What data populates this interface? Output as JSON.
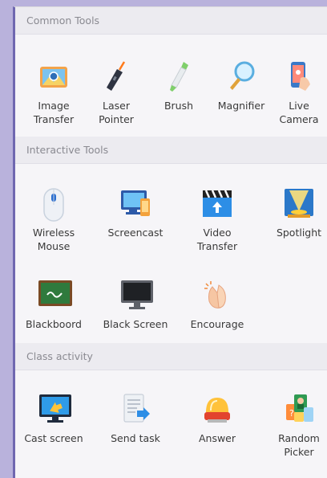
{
  "sections": [
    {
      "title": "Common Tools",
      "tools": [
        {
          "label": "Image\nTransfer",
          "icon": "image-transfer-icon"
        },
        {
          "label": "Laser\nPointer",
          "icon": "laser-pointer-icon"
        },
        {
          "label": "Brush",
          "icon": "brush-icon"
        },
        {
          "label": "Magnifier",
          "icon": "magnifier-icon"
        },
        {
          "label": "Live\nCamera",
          "icon": "live-camera-icon"
        }
      ]
    },
    {
      "title": "Interactive Tools",
      "tools": [
        {
          "label": "Wireless\nMouse",
          "icon": "wireless-mouse-icon"
        },
        {
          "label": "Screencast",
          "icon": "screencast-icon"
        },
        {
          "label": "Video\nTransfer",
          "icon": "video-transfer-icon"
        },
        {
          "label": "Spotlight",
          "icon": "spotlight-icon"
        },
        {
          "label": "Blackboord",
          "icon": "blackboard-icon"
        },
        {
          "label": "Black Screen",
          "icon": "black-screen-icon"
        },
        {
          "label": "Encourage",
          "icon": "encourage-icon"
        }
      ]
    },
    {
      "title": "Class activity",
      "tools": [
        {
          "label": "Cast screen",
          "icon": "cast-screen-icon"
        },
        {
          "label": "Send task",
          "icon": "send-task-icon"
        },
        {
          "label": "Answer",
          "icon": "answer-icon"
        },
        {
          "label": "Random\nPicker",
          "icon": "random-picker-icon"
        }
      ]
    }
  ],
  "colors": {
    "background": "#b9b2dc",
    "panel": "#f6f5f8",
    "panel_border": "#6f67b0",
    "section_header": "#ecebf0"
  }
}
